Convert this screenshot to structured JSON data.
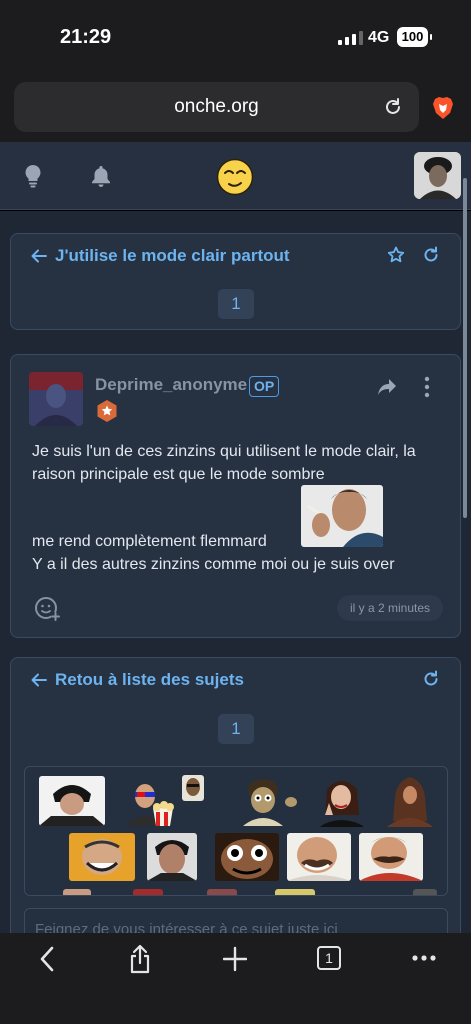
{
  "status_bar": {
    "time": "21:29",
    "network": "4G",
    "battery": "100"
  },
  "browser": {
    "url": "onche.org",
    "tab_count": "1"
  },
  "topic_header": {
    "title": "J'utilise le mode clair partout",
    "page": "1"
  },
  "post": {
    "author": "Deprime_anonyme",
    "op_badge": "OP",
    "line1": "Je suis l'un de ces zinzins qui utilisent le mode clair, la raison principale est que le mode sombre",
    "line2": "me rend complètement flemmard",
    "line3": "Y a il des autres zinzins comme moi ou je suis over",
    "timestamp": "il y a 2 minutes"
  },
  "footer_nav": {
    "back_label": "Retou à liste des sujets",
    "page": "1"
  },
  "reply": {
    "placeholder": "Feignez de vous intéresser à ce sujet juste ici"
  },
  "colors": {
    "accent": "#6db3ef",
    "card_bg": "#263142",
    "page_bg": "#1f2735",
    "header_bg": "#263041"
  },
  "icons": [
    "reload-icon",
    "brave-lion-icon",
    "lightbulb-icon",
    "bell-icon",
    "smiley-icon",
    "back-arrow-icon",
    "star-icon",
    "refresh-icon",
    "share-icon",
    "more-icon",
    "add-reaction-icon",
    "chevron-left-icon",
    "share-sheet-icon",
    "plus-icon",
    "tabs-icon",
    "ellipsis-icon"
  ]
}
